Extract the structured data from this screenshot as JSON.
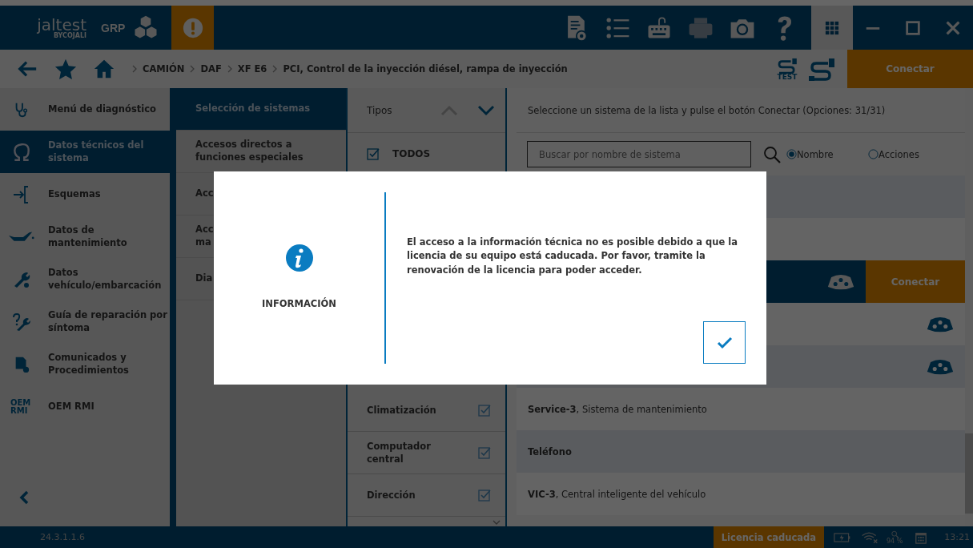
{
  "top_bar": {
    "logo": "jaltest",
    "logo_sub": "BYCOJALI",
    "mode": "GRP"
  },
  "breadcrumb": [
    "CAMIÓN",
    "DAF",
    "XF E6",
    "PCI, Control de la inyección diésel, rampa de inyección"
  ],
  "test_label": "TEST",
  "connect_button": "Conectar",
  "sidebar": {
    "items": [
      {
        "label": "Menú de diagnóstico",
        "selected": false
      },
      {
        "label": "Datos técnicos del sistema",
        "selected": true
      },
      {
        "label": "Esquemas",
        "selected": false
      },
      {
        "label": "Datos de mantenimiento",
        "selected": false
      },
      {
        "label": "Datos vehículo/embarcación",
        "selected": false
      },
      {
        "label": "Guía de reparación por síntoma",
        "selected": false
      },
      {
        "label": "Comunicados y Procedimientos",
        "selected": false
      },
      {
        "label": "OEM RMI",
        "icon_text": "OEM RMI",
        "selected": false
      }
    ]
  },
  "sections": [
    {
      "label": "Selección de sistemas",
      "selected": true
    },
    {
      "label": "Accesos directos a funciones especiales",
      "selected": false
    },
    {
      "label": "Acc",
      "selected": false
    },
    {
      "label": "Acc\nma",
      "selected": false
    },
    {
      "label": "Dia",
      "selected": false
    }
  ],
  "types": {
    "title": "Tipos",
    "all": {
      "label": "TODOS",
      "checked": true
    },
    "items": [
      {
        "label": "Climatización",
        "checked": true
      },
      {
        "label": "Computador central",
        "checked": true
      },
      {
        "label": "Dirección",
        "checked": true
      }
    ]
  },
  "systems": {
    "instruction": "Seleccione un sistema de la lista y pulse el botón Conectar (Opciones: 31/31)",
    "search": {
      "placeholder": "Buscar por nombre de sistema"
    },
    "search_by": [
      {
        "label": "Nombre",
        "selected": true
      },
      {
        "label": "Acciones",
        "selected": false
      }
    ],
    "rows": [
      {
        "selected": false
      },
      {
        "selected": false
      },
      {
        "selected": true,
        "connector": true,
        "connect_label": "Conectar"
      },
      {
        "selected": false,
        "connector": true
      },
      {
        "selected": false,
        "connector": true
      },
      {
        "selected": false,
        "label": "**Service-3**, Sistema de mantenimiento"
      },
      {
        "selected": false,
        "label": "Teléfono",
        "bold": true
      },
      {
        "selected": false,
        "label": "**VIC-3**, Central inteligente del vehículo"
      }
    ]
  },
  "dialog": {
    "title": "INFORMACIÓN",
    "message": "El acceso a la información técnica no es posible debido a que la licencia de su equipo está caducada. Por favor, tramite la renovación de la licencia para poder acceder."
  },
  "status_bar": {
    "version": "24.3.1.1.6",
    "license": "Licencia caducada",
    "signal_reading": "94 %",
    "time": "13:21"
  }
}
